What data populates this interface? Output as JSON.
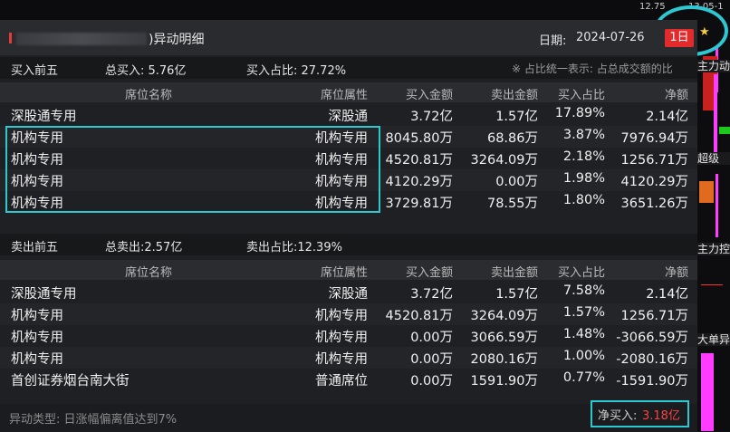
{
  "top_scale": {
    "left": "12.75",
    "right": "13.05-1"
  },
  "dialog": {
    "title_suffix": ")异动明细",
    "title_prefix": "(",
    "date_label": "日期:",
    "date_value": "2024-07-26",
    "period_button": "1日"
  },
  "buy_section": {
    "label": "买入前五",
    "total": "总买入: 5.76亿",
    "ratio": "买入占比: 27.72%",
    "note": "※ 占比统一表示: 占总成交额的比"
  },
  "sell_section": {
    "label": "卖出前五",
    "total": "总卖出:2.57亿",
    "ratio": "卖出占比:12.39%"
  },
  "columns": [
    "席位名称",
    "席位属性",
    "买入金额",
    "卖出金额",
    "买入占比",
    "净额"
  ],
  "buy_rows": [
    {
      "name": "深股通专用",
      "attr": "深股通",
      "buy": "3.72亿",
      "sell": "1.57亿",
      "ratio": "17.89%",
      "net": "2.14亿"
    },
    {
      "name": "机构专用",
      "attr": "机构专用",
      "buy": "8045.80万",
      "sell": "68.86万",
      "ratio": "3.87%",
      "net": "7976.94万"
    },
    {
      "name": "机构专用",
      "attr": "机构专用",
      "buy": "4520.81万",
      "sell": "3264.09万",
      "ratio": "2.18%",
      "net": "1256.71万"
    },
    {
      "name": "机构专用",
      "attr": "机构专用",
      "buy": "4120.29万",
      "sell": "0.00万",
      "ratio": "1.98%",
      "net": "4120.29万"
    },
    {
      "name": "机构专用",
      "attr": "机构专用",
      "buy": "3729.81万",
      "sell": "78.55万",
      "ratio": "1.80%",
      "net": "3651.26万"
    }
  ],
  "sell_rows": [
    {
      "name": "深股通专用",
      "attr": "深股通",
      "buy": "3.72亿",
      "sell": "1.57亿",
      "ratio": "7.58%",
      "net": "2.14亿"
    },
    {
      "name": "机构专用",
      "attr": "机构专用",
      "buy": "4520.81万",
      "sell": "3264.09万",
      "ratio": "1.57%",
      "net": "1256.71万"
    },
    {
      "name": "机构专用",
      "attr": "机构专用",
      "buy": "0.00万",
      "sell": "3066.59万",
      "ratio": "1.48%",
      "net": "-3066.59万"
    },
    {
      "name": "机构专用",
      "attr": "机构专用",
      "buy": "0.00万",
      "sell": "2080.16万",
      "ratio": "1.00%",
      "net": "-2080.16万"
    },
    {
      "name": "首创证券烟台南大街",
      "attr": "普通席位",
      "buy": "0.00万",
      "sell": "1591.90万",
      "ratio": "0.77%",
      "net": "-1591.90万"
    }
  ],
  "footer": {
    "type_text": "异动类型: 日涨幅偏离值达到7%",
    "net_buy_label": "净买入:",
    "net_buy_value": "3.18亿"
  },
  "side_panel": {
    "labels": [
      "主力动向",
      "超级",
      "主力控盘",
      "大单异动"
    ]
  },
  "colors": {
    "accent_highlight": "#2ec8d2",
    "badge_red": "#e32b2b",
    "net_red": "#ff4040"
  }
}
